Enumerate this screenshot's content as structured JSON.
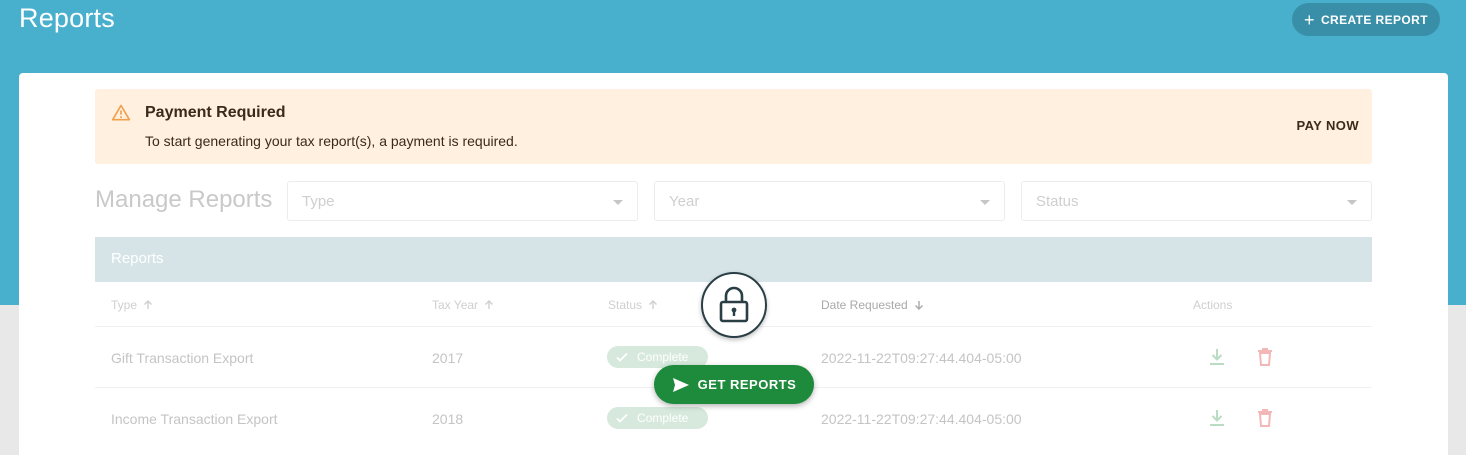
{
  "header": {
    "title": "Reports",
    "create_label": "CREATE REPORT"
  },
  "alert": {
    "title": "Payment Required",
    "message": "To start generating your tax report(s), a payment is required.",
    "action_label": "PAY NOW"
  },
  "manage": {
    "title": "Manage Reports",
    "filters": [
      {
        "placeholder": "Type"
      },
      {
        "placeholder": "Year"
      },
      {
        "placeholder": "Status"
      }
    ]
  },
  "table": {
    "section_label": "Reports",
    "columns": [
      {
        "label": "Type",
        "sort": "asc"
      },
      {
        "label": "Tax Year",
        "sort": "asc"
      },
      {
        "label": "Status",
        "sort": "asc"
      },
      {
        "label": "Date Requested",
        "sort": "desc"
      },
      {
        "label": "Actions"
      }
    ],
    "rows": [
      {
        "type": "Gift Transaction Export",
        "tax_year": "2017",
        "status": "Complete",
        "date_requested": "2022-11-22T09:27:44.404-05:00"
      },
      {
        "type": "Income Transaction Export",
        "tax_year": "2018",
        "status": "Complete",
        "date_requested": "2022-11-22T09:27:44.404-05:00"
      }
    ]
  },
  "overlay": {
    "button_label": "GET REPORTS"
  },
  "colors": {
    "header_bg": "#48afcd",
    "alert_bg": "#fff0e0",
    "alert_icon": "#f0a04b",
    "primary_green": "#1e8a3c",
    "delete_red": "#f3b7b7",
    "download_green": "#b8dcc4"
  },
  "icons": [
    "plus-icon",
    "warning-icon",
    "caret-down-icon",
    "arrow-up-icon",
    "arrow-down-icon",
    "check-icon",
    "download-icon",
    "trash-icon",
    "lock-icon",
    "send-icon"
  ]
}
